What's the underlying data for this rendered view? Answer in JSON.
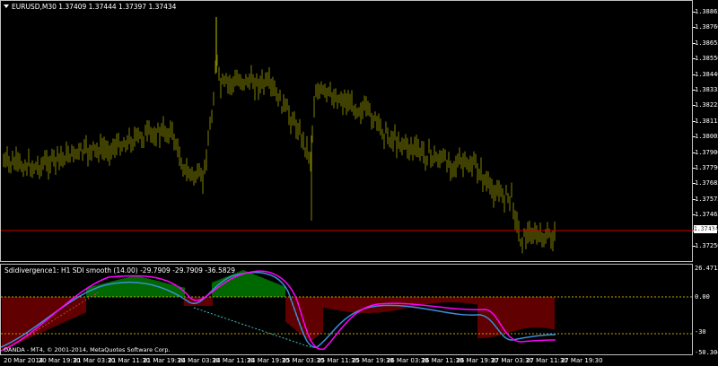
{
  "main_chart": {
    "header": "EURUSD,M30  1.37409 1.37444 1.37397 1.37434",
    "current_price": "1.37434",
    "price_axis": [
      "1.38865",
      "1.38760",
      "1.38655",
      "1.38550",
      "1.38440",
      "1.38335",
      "1.38225",
      "1.38115",
      "1.38005",
      "1.37900",
      "1.37790",
      "1.37685",
      "1.37575",
      "1.37465",
      "1.37360",
      "1.37250"
    ],
    "colors": {
      "candle": "#808000",
      "price_line": "#cc0000"
    }
  },
  "indicator": {
    "header": "Sdidivergence1: H1  SDI smooth (14.00) -29.7909 -29.7909 -36.5829",
    "axis": [
      "26.4712",
      "0.00",
      "-30",
      "-50.3047"
    ],
    "copyright": "OANDA - MT4, © 2001-2014, MetaQuotes Software Corp.",
    "colors": {
      "pos_hist": "#00d000",
      "neg_hist": "#c00000",
      "line_blue": "#3a8fd8",
      "line_magenta": "#ff00ff",
      "level": "#c8a000"
    }
  },
  "time_axis": [
    "20 Mar 2014",
    "20 Mar 19:30",
    "21 Mar 03:30",
    "21 Mar 11:30",
    "21 Mar 19:30",
    "24 Mar 03:30",
    "24 Mar 11:30",
    "24 Mar 19:30",
    "25 Mar 03:30",
    "25 Mar 11:30",
    "25 Mar 19:30",
    "26 Mar 03:30",
    "26 Mar 11:30",
    "26 Mar 19:30",
    "27 Mar 03:30",
    "27 Mar 11:30",
    "27 Mar 19:30"
  ]
}
